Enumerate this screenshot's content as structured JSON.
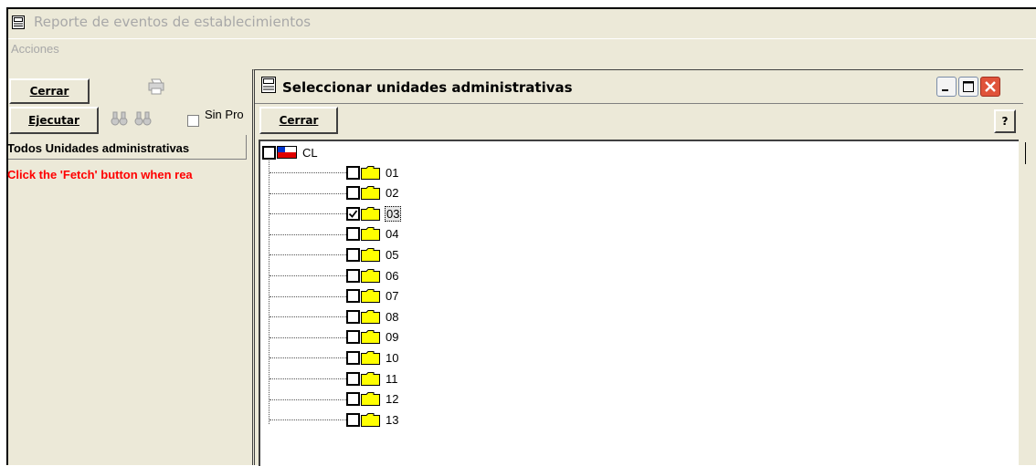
{
  "window": {
    "title": "Reporte de eventos de establecimientos"
  },
  "menu": {
    "items": [
      "Acciones"
    ]
  },
  "toolbar": {
    "close_label": "Cerrar",
    "run_label": "Ejecutar",
    "sin_pro_label": "Sin Pro"
  },
  "panel": {
    "header": "Todos Unidades administrativas",
    "fetch_message": "Click the 'Fetch' button when rea"
  },
  "dialog": {
    "title": "Seleccionar unidades administrativas",
    "close_label": "Cerrar",
    "help_icon": "?",
    "tree": {
      "root": {
        "label": "CL",
        "checked": false
      },
      "children": [
        {
          "label": "01",
          "checked": false
        },
        {
          "label": "02",
          "checked": false
        },
        {
          "label": "03",
          "checked": true,
          "selected": true
        },
        {
          "label": "04",
          "checked": false
        },
        {
          "label": "05",
          "checked": false
        },
        {
          "label": "06",
          "checked": false
        },
        {
          "label": "07",
          "checked": false
        },
        {
          "label": "08",
          "checked": false
        },
        {
          "label": "09",
          "checked": false
        },
        {
          "label": "10",
          "checked": false
        },
        {
          "label": "11",
          "checked": false
        },
        {
          "label": "12",
          "checked": false
        },
        {
          "label": "13",
          "checked": false
        }
      ]
    }
  },
  "colors": {
    "face": "#ece9d8",
    "folder": "#ffff00",
    "error_text": "#ff0000",
    "close_btn": "#e0533a"
  }
}
